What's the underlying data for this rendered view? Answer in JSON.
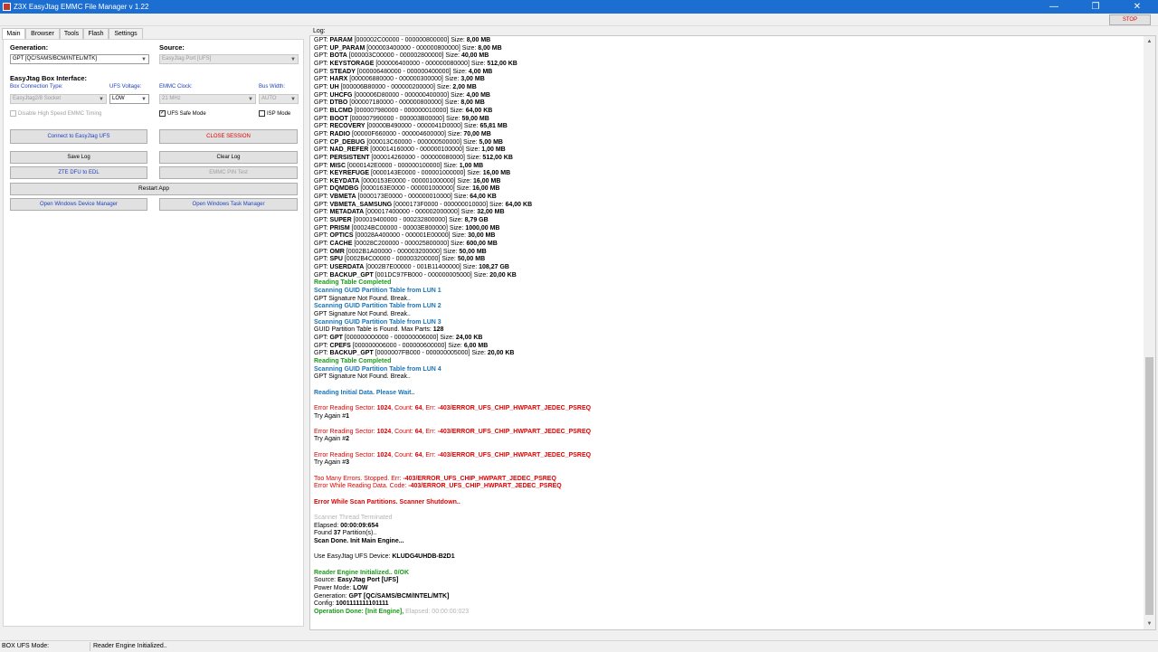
{
  "window": {
    "title": "Z3X EasyJtag EMMC File Manager v 1.22",
    "minimize_glyph": "—",
    "maximize_glyph": "❐",
    "close_glyph": "✕",
    "stop_label": "STOP"
  },
  "tabs": [
    "Main",
    "Browser",
    "Tools",
    "Flash",
    "Settings"
  ],
  "left": {
    "generation_label": "Generation:",
    "generation_value": "GPT [QC/SAMS/BCM/INTEL/MTK]",
    "source_label": "Source:",
    "source_value": "EasyJtag Port [UFS]",
    "box_interface_label": "EasyJtag Box Interface:",
    "box_conn_type_label": "Box Connection Type:",
    "box_conn_type_value": "EasyJtag2/8 Socket",
    "ufs_voltage_label": "UFS Voltage:",
    "ufs_voltage_value": "LOW",
    "emmc_clock_label": "EMMC Clock:",
    "emmc_clock_value": "21 MHz",
    "bus_width_label": "Bus Width:",
    "bus_width_value": "AUTO",
    "disable_hs_label": "Disable High Speed EMMC Timing",
    "ufs_safe_label": "UFS Safe Mode",
    "ufs_safe_check": "✓",
    "isp_mode_label": "ISP Mode",
    "buttons": {
      "connect": "Connect to EasyJtag UFS",
      "close_session": "CLOSE SESSION",
      "save_log": "Save Log",
      "clear_log": "Clear Log",
      "zte_dfu": "ZTE DFU to EDL",
      "emmc_pin": "EMMC PIN Test",
      "restart": "Restart App",
      "device_manager": "Open Windows Device Manager",
      "task_manager": "Open Windows Task Manager"
    }
  },
  "log": {
    "label": "Log:",
    "scroll_up": "▲",
    "scroll_down": "▼",
    "lines": [
      [
        [
          "GPT: "
        ],
        [
          "PARAM",
          "b"
        ],
        [
          "  [000002C00000 - 000000800000] Size: "
        ],
        [
          "8,00 MB",
          "b"
        ]
      ],
      [
        [
          "GPT: "
        ],
        [
          "UP_PARAM",
          "b"
        ],
        [
          "  [000003400000 - 000000800000] Size: "
        ],
        [
          "8,00 MB",
          "b"
        ]
      ],
      [
        [
          "GPT: "
        ],
        [
          "BOTA",
          "b"
        ],
        [
          "  [000003C00000 - 000002800000] Size: "
        ],
        [
          "40,00 MB",
          "b"
        ]
      ],
      [
        [
          "GPT: "
        ],
        [
          "KEYSTORAGE",
          "b"
        ],
        [
          "  [000006400000 - 000000080000] Size: "
        ],
        [
          "512,00 KB",
          "b"
        ]
      ],
      [
        [
          "GPT: "
        ],
        [
          "STEADY",
          "b"
        ],
        [
          "  [000006480000 - 000000400000] Size: "
        ],
        [
          "4,00 MB",
          "b"
        ]
      ],
      [
        [
          "GPT: "
        ],
        [
          "HARX",
          "b"
        ],
        [
          "  [000006880000 - 000000300000] Size: "
        ],
        [
          "3,00 MB",
          "b"
        ]
      ],
      [
        [
          "GPT: "
        ],
        [
          "UH",
          "b"
        ],
        [
          "  [000006B80000 - 000000200000] Size: "
        ],
        [
          "2,00 MB",
          "b"
        ]
      ],
      [
        [
          "GPT: "
        ],
        [
          "UHCFG",
          "b"
        ],
        [
          "  [000006D80000 - 000000400000] Size: "
        ],
        [
          "4,00 MB",
          "b"
        ]
      ],
      [
        [
          "GPT: "
        ],
        [
          "DTBO",
          "b"
        ],
        [
          "  [000007180000 - 000000800000] Size: "
        ],
        [
          "8,00 MB",
          "b"
        ]
      ],
      [
        [
          "GPT: "
        ],
        [
          "BLCMD",
          "b"
        ],
        [
          "  [000007980000 - 000000010000] Size: "
        ],
        [
          "64,00 KB",
          "b"
        ]
      ],
      [
        [
          "GPT: "
        ],
        [
          "BOOT",
          "b"
        ],
        [
          "  [000007990000 - 000003B00000] Size: "
        ],
        [
          "59,00 MB",
          "b"
        ]
      ],
      [
        [
          "GPT: "
        ],
        [
          "RECOVERY",
          "b"
        ],
        [
          "  [00000B490000 - 0000041D0000] Size: "
        ],
        [
          "65,81 MB",
          "b"
        ]
      ],
      [
        [
          "GPT: "
        ],
        [
          "RADIO",
          "b"
        ],
        [
          "  [00000F660000 - 000004600000] Size: "
        ],
        [
          "70,00 MB",
          "b"
        ]
      ],
      [
        [
          "GPT: "
        ],
        [
          "CP_DEBUG",
          "b"
        ],
        [
          "  [000013C60000 - 000000500000] Size: "
        ],
        [
          "5,00 MB",
          "b"
        ]
      ],
      [
        [
          "GPT: "
        ],
        [
          "NAD_REFER",
          "b"
        ],
        [
          "  [000014160000 - 000000100000] Size: "
        ],
        [
          "1,00 MB",
          "b"
        ]
      ],
      [
        [
          "GPT: "
        ],
        [
          "PERSISTENT",
          "b"
        ],
        [
          "  [000014260000 - 000000080000] Size: "
        ],
        [
          "512,00 KB",
          "b"
        ]
      ],
      [
        [
          "GPT: "
        ],
        [
          "MISC",
          "b"
        ],
        [
          "  [0000142E0000 - 000000100000] Size: "
        ],
        [
          "1,00 MB",
          "b"
        ]
      ],
      [
        [
          "GPT: "
        ],
        [
          "KEYREFUGE",
          "b"
        ],
        [
          "  [0000143E0000 - 000001000000] Size: "
        ],
        [
          "16,00 MB",
          "b"
        ]
      ],
      [
        [
          "GPT: "
        ],
        [
          "KEYDATA",
          "b"
        ],
        [
          "  [0000153E0000 - 000001000000] Size: "
        ],
        [
          "16,00 MB",
          "b"
        ]
      ],
      [
        [
          "GPT: "
        ],
        [
          "DQMDBG",
          "b"
        ],
        [
          "  [0000163E0000 - 000001000000] Size: "
        ],
        [
          "16,00 MB",
          "b"
        ]
      ],
      [
        [
          "GPT: "
        ],
        [
          "VBMETA",
          "b"
        ],
        [
          "  [0000173E0000 - 000000010000] Size: "
        ],
        [
          "64,00 KB",
          "b"
        ]
      ],
      [
        [
          "GPT: "
        ],
        [
          "VBMETA_SAMSUNG",
          "b"
        ],
        [
          "  [0000173F0000 - 000000010000] Size: "
        ],
        [
          "64,00 KB",
          "b"
        ]
      ],
      [
        [
          "GPT: "
        ],
        [
          "METADATA",
          "b"
        ],
        [
          "  [000017400000 - 000002000000] Size: "
        ],
        [
          "32,00 MB",
          "b"
        ]
      ],
      [
        [
          "GPT: "
        ],
        [
          "SUPER",
          "b"
        ],
        [
          "  [000019400000 - 000232800000] Size: "
        ],
        [
          "8,79 GB",
          "b"
        ]
      ],
      [
        [
          "GPT: "
        ],
        [
          "PRISM",
          "b"
        ],
        [
          "  [00024BC00000 - 00003E800000] Size: "
        ],
        [
          "1000,00 MB",
          "b"
        ]
      ],
      [
        [
          "GPT: "
        ],
        [
          "OPTICS",
          "b"
        ],
        [
          "  [00028A400000 - 000001E00000] Size: "
        ],
        [
          "30,00 MB",
          "b"
        ]
      ],
      [
        [
          "GPT: "
        ],
        [
          "CACHE",
          "b"
        ],
        [
          "  [00028C200000 - 000025800000] Size: "
        ],
        [
          "600,00 MB",
          "b"
        ]
      ],
      [
        [
          "GPT: "
        ],
        [
          "OMR",
          "b"
        ],
        [
          "  [0002B1A00000 - 000003200000] Size: "
        ],
        [
          "50,00 MB",
          "b"
        ]
      ],
      [
        [
          "GPT: "
        ],
        [
          "SPU",
          "b"
        ],
        [
          "  [0002B4C00000 - 000003200000] Size: "
        ],
        [
          "50,00 MB",
          "b"
        ]
      ],
      [
        [
          "GPT: "
        ],
        [
          "USERDATA",
          "b"
        ],
        [
          "  [0002B7E00000 - 001B11400000] Size: "
        ],
        [
          "108,27 GB",
          "b"
        ]
      ],
      [
        [
          "GPT: "
        ],
        [
          "BACKUP_GPT",
          "b"
        ],
        [
          "  [001DC97FB000 - 000000005000] Size: "
        ],
        [
          "20,00 KB",
          "b"
        ]
      ],
      [
        [
          "Reading Table Completed",
          "c-green"
        ]
      ],
      [
        [
          "Scanning GUID Partition Table from LUN 1",
          "c-blue"
        ]
      ],
      [
        [
          "GPT Signature Not Found. Break.."
        ]
      ],
      [
        [
          "Scanning GUID Partition Table from LUN 2",
          "c-blue"
        ]
      ],
      [
        [
          "GPT Signature Not Found. Break.."
        ]
      ],
      [
        [
          "Scanning GUID Partition Table from LUN 3",
          "c-blue"
        ]
      ],
      [
        [
          "GUID Partition Table is Found. Max Parts: "
        ],
        [
          "128",
          "b"
        ]
      ],
      [
        [
          "GPT: "
        ],
        [
          "GPT",
          "b"
        ],
        [
          "  [000000000000 - 000000006000] Size: "
        ],
        [
          "24,00 KB",
          "b"
        ]
      ],
      [
        [
          "GPT: "
        ],
        [
          "CPEFS",
          "b"
        ],
        [
          "  [000000006000 - 000000600000] Size: "
        ],
        [
          "6,00 MB",
          "b"
        ]
      ],
      [
        [
          "GPT: "
        ],
        [
          "BACKUP_GPT",
          "b"
        ],
        [
          "  [0000007FB000 - 000000005000] Size: "
        ],
        [
          "20,00 KB",
          "b"
        ]
      ],
      [
        [
          "Reading Table Completed",
          "c-green"
        ]
      ],
      [
        [
          "Scanning GUID Partition Table from LUN 4",
          "c-blue"
        ]
      ],
      [
        [
          "GPT Signature Not Found. Break.."
        ]
      ],
      [],
      [
        [
          "Reading Initial Data. Please Wait..",
          "c-blue"
        ]
      ],
      [],
      [
        [
          "Error Reading Sector: ",
          "c-red"
        ],
        [
          "1024",
          "c-red b"
        ],
        [
          ", Count: ",
          "c-red"
        ],
        [
          "64",
          "c-red b"
        ],
        [
          ", Err: ",
          "c-red"
        ],
        [
          "-403/ERROR_UFS_CHIP_HWPART_JEDEC_PSREQ",
          "c-red b"
        ]
      ],
      [
        [
          "Try Again #"
        ],
        [
          "1",
          "b"
        ]
      ],
      [],
      [
        [
          "Error Reading Sector: ",
          "c-red"
        ],
        [
          "1024",
          "c-red b"
        ],
        [
          ", Count: ",
          "c-red"
        ],
        [
          "64",
          "c-red b"
        ],
        [
          ", Err: ",
          "c-red"
        ],
        [
          "-403/ERROR_UFS_CHIP_HWPART_JEDEC_PSREQ",
          "c-red b"
        ]
      ],
      [
        [
          "Try Again #"
        ],
        [
          "2",
          "b"
        ]
      ],
      [],
      [
        [
          "Error Reading Sector: ",
          "c-red"
        ],
        [
          "1024",
          "c-red b"
        ],
        [
          ", Count: ",
          "c-red"
        ],
        [
          "64",
          "c-red b"
        ],
        [
          ", Err: ",
          "c-red"
        ],
        [
          "-403/ERROR_UFS_CHIP_HWPART_JEDEC_PSREQ",
          "c-red b"
        ]
      ],
      [
        [
          "Try Again #"
        ],
        [
          "3",
          "b"
        ]
      ],
      [],
      [
        [
          "Too Many Errors. Stopped. Err: ",
          "c-red"
        ],
        [
          "-403/ERROR_UFS_CHIP_HWPART_JEDEC_PSREQ",
          "c-red b"
        ]
      ],
      [
        [
          "Error While Reading Data. Code: ",
          "c-red"
        ],
        [
          "-403/ERROR_UFS_CHIP_HWPART_JEDEC_PSREQ",
          "c-red b"
        ]
      ],
      [],
      [
        [
          "Error While Scan Partitions. Scanner Shutdown..",
          "c-red b"
        ]
      ],
      [],
      [
        [
          "Scanner Thread Terminated",
          "c-gray"
        ]
      ],
      [
        [
          "Elapsed: "
        ],
        [
          "00:00:09:654",
          "b"
        ]
      ],
      [
        [
          "Found "
        ],
        [
          "37",
          "b"
        ],
        [
          " Partition(s).."
        ]
      ],
      [
        [
          "Scan Done. Init Main Engine...",
          "b"
        ]
      ],
      [],
      [
        [
          "Use EasyJtag UFS Device: "
        ],
        [
          "KLUDG4UHDB-B2D1",
          "b"
        ]
      ],
      [],
      [
        [
          "Reader Engine Initialized.. 0/OK",
          "c-green"
        ]
      ],
      [
        [
          "Source: "
        ],
        [
          "EasyJtag Port [UFS]",
          "b"
        ]
      ],
      [
        [
          "Power Mode: "
        ],
        [
          "LOW",
          "b"
        ]
      ],
      [
        [
          "Generation: "
        ],
        [
          "GPT [QC/SAMS/BCM/INTEL/MTK]",
          "b"
        ]
      ],
      [
        [
          "Config: "
        ],
        [
          "1001111111101111",
          "b"
        ]
      ],
      [
        [
          "Operation Done: ",
          "c-green"
        ],
        [
          "[Init Engine]",
          "c-green"
        ],
        [
          ", ",
          "c-green"
        ],
        [
          "Elapsed: 00:00:00:023",
          "c-gray"
        ]
      ]
    ]
  },
  "status": {
    "mode": "BOX UFS Mode:",
    "message": "Reader Engine Initialized.."
  }
}
